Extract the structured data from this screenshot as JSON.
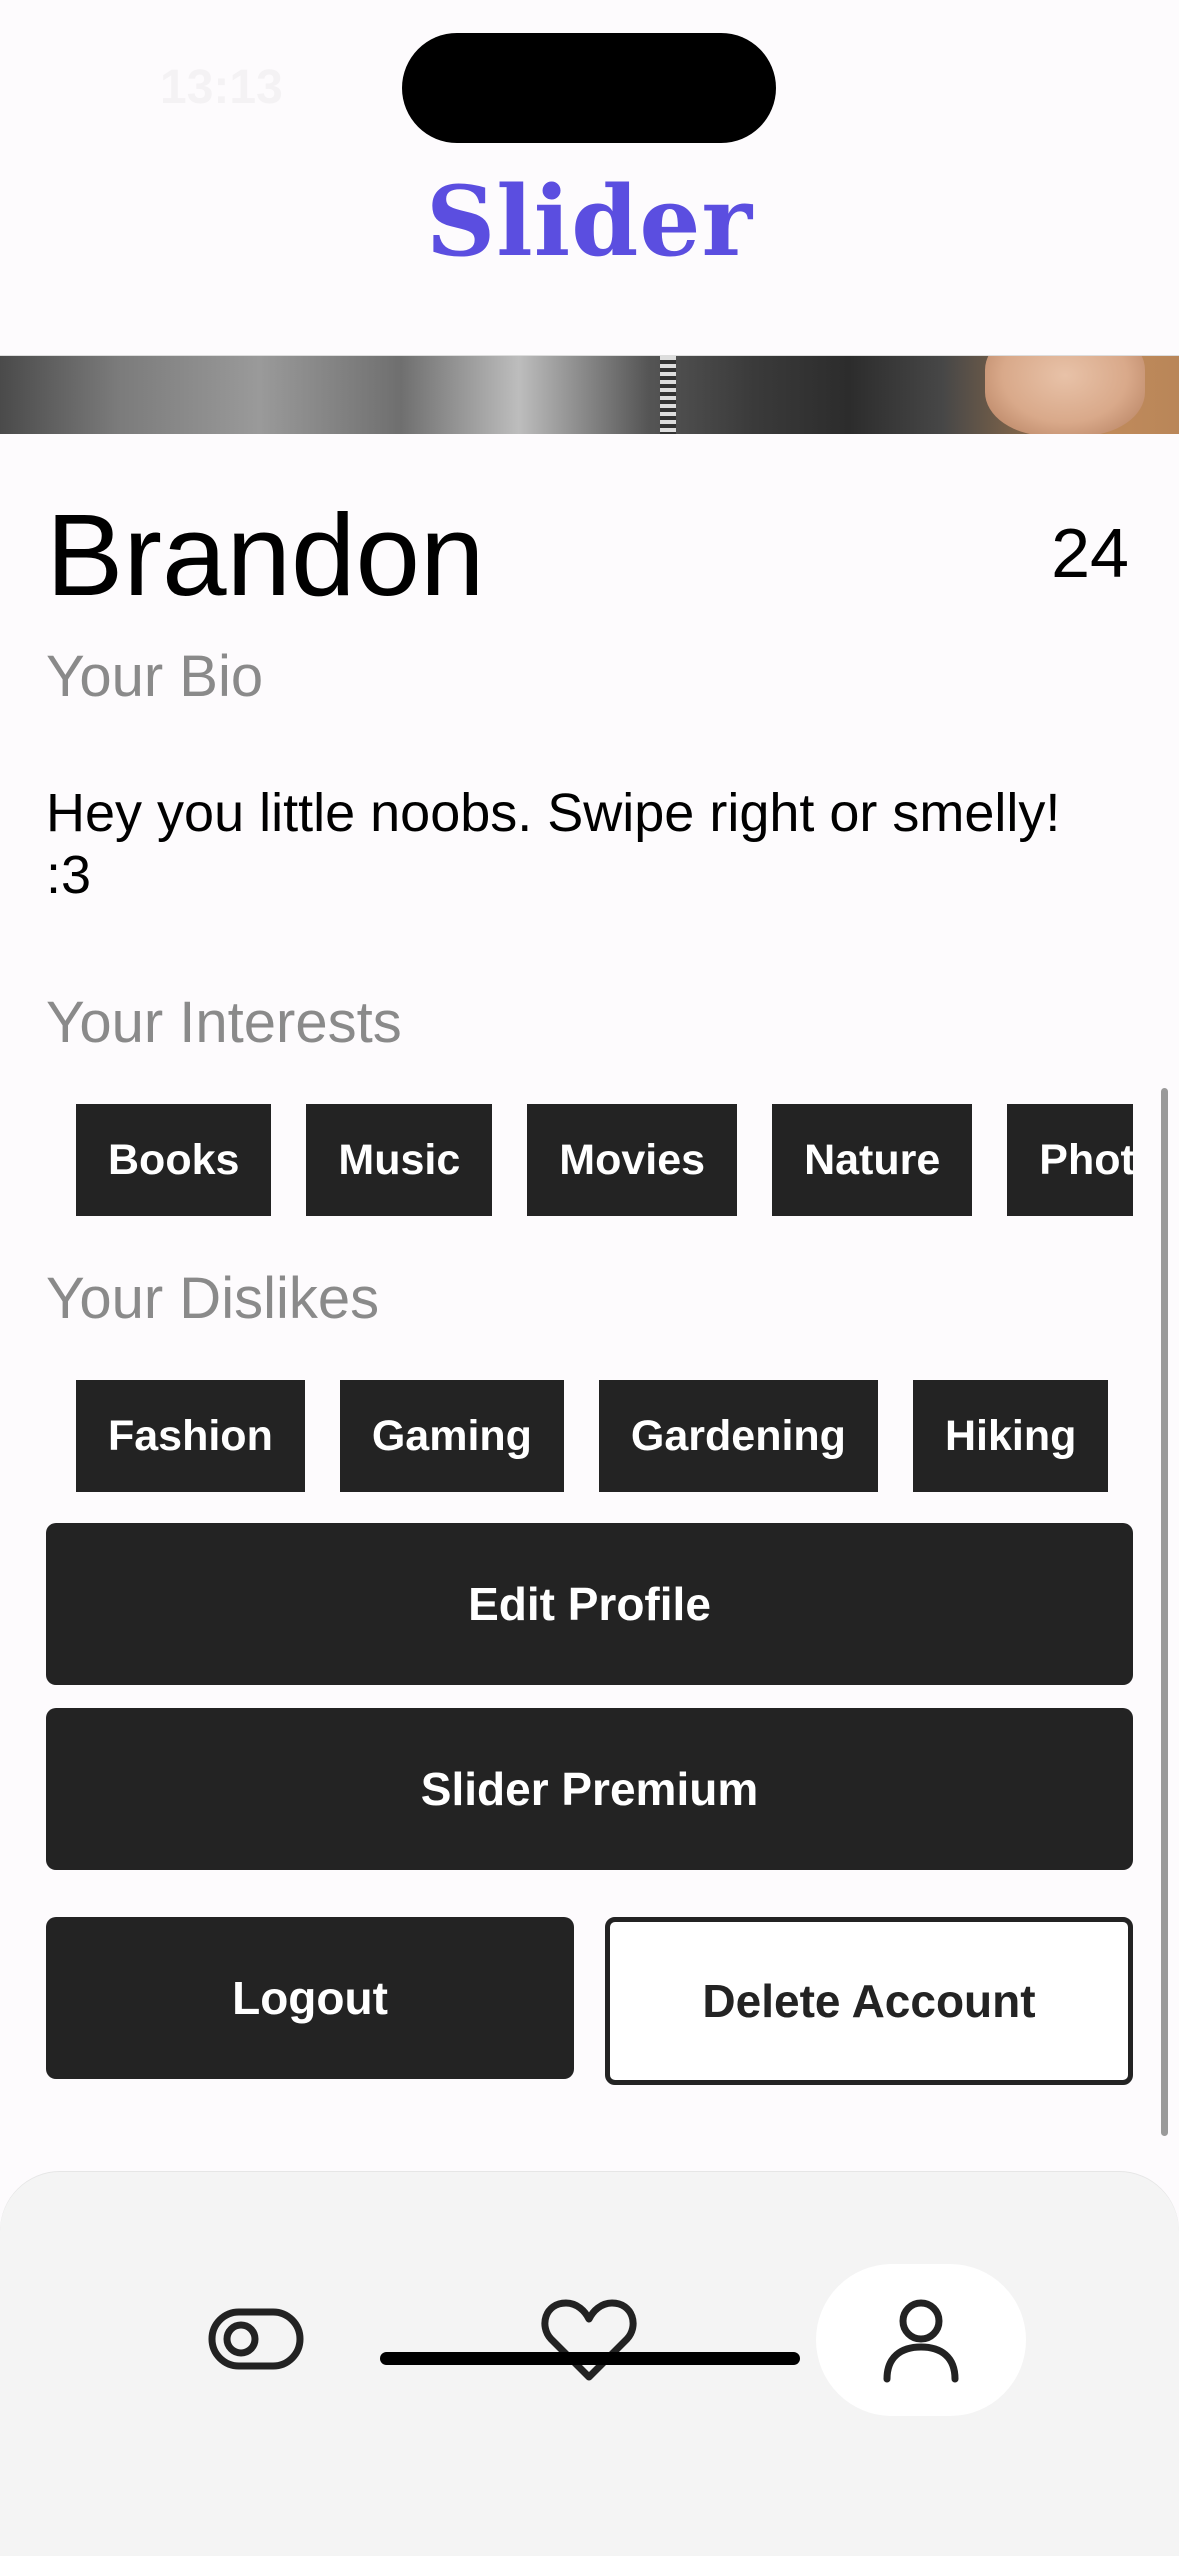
{
  "status_bar": {
    "time": "13:13"
  },
  "app": {
    "title": "Slider",
    "accent_color": "#5b4ee0"
  },
  "profile": {
    "name": "Brandon",
    "age": "24",
    "bio_label": "Your Bio",
    "bio": "Hey you little noobs. Swipe right or smelly! :3",
    "interests_label": "Your Interests",
    "interests": [
      "Books",
      "Music",
      "Movies",
      "Nature",
      "Phot"
    ],
    "dislikes_label": "Your Dislikes",
    "dislikes": [
      "Fashion",
      "Gaming",
      "Gardening",
      "Hiking"
    ]
  },
  "actions": {
    "edit_profile": "Edit Profile",
    "premium": "Slider Premium",
    "logout": "Logout",
    "delete_account": "Delete Account"
  },
  "tab_bar": {
    "tabs": [
      {
        "icon": "toggle-icon",
        "active": false
      },
      {
        "icon": "heart-icon",
        "active": false
      },
      {
        "icon": "profile-icon",
        "active": true
      }
    ]
  }
}
